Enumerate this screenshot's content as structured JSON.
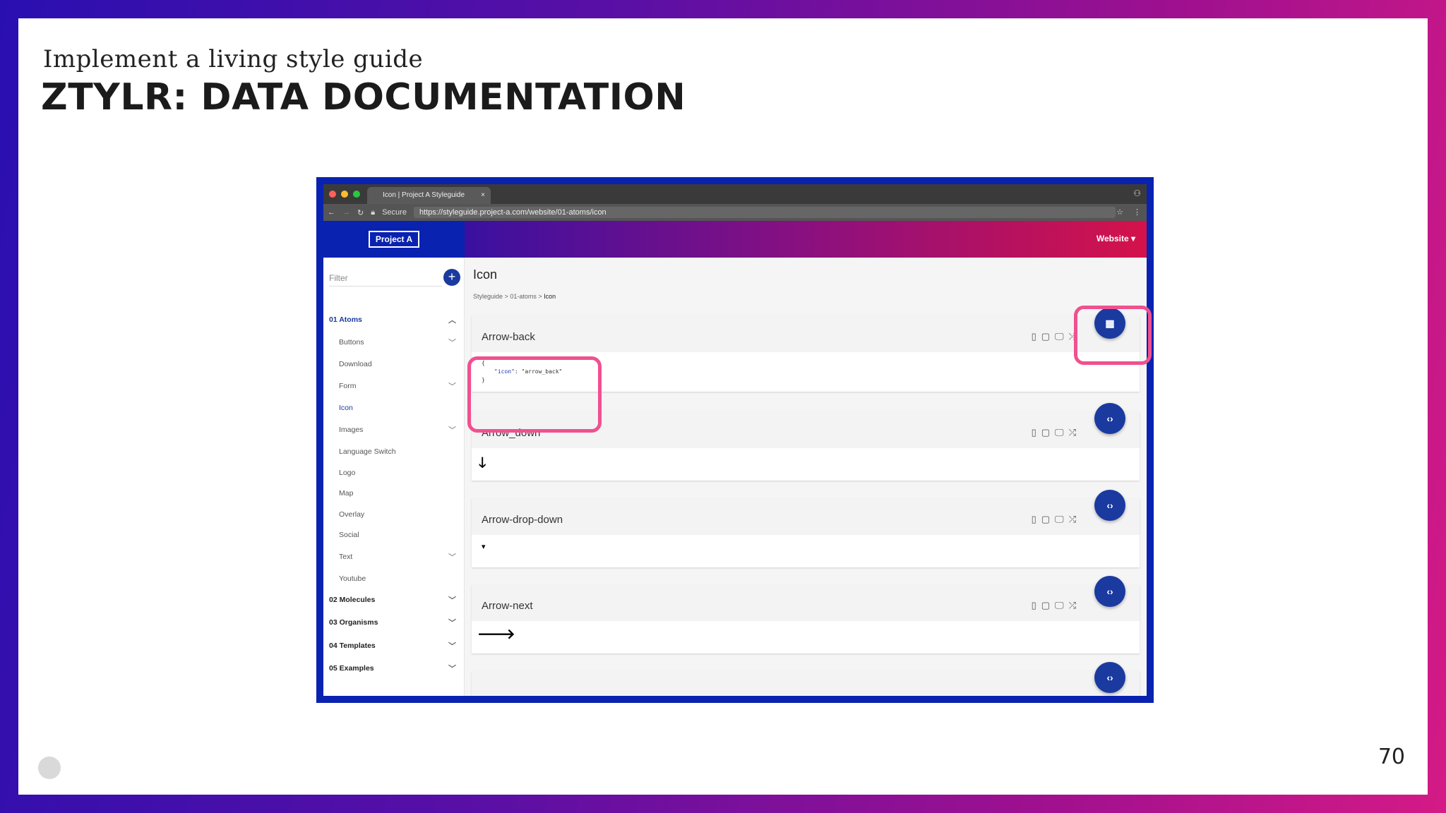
{
  "slide": {
    "subtitle": "Implement a living style guide",
    "title": "ZTYLR: DATA DOCUMENTATION",
    "page_number": "70"
  },
  "browser": {
    "tab_title": "Icon | Project A Styleguide",
    "tab_close": "×",
    "secure_label": "Secure",
    "url": "https://styleguide.project-a.com/website/01-atoms/icon"
  },
  "app": {
    "logo": "Project A",
    "site_dropdown": "Website ▾",
    "filter_placeholder": "Filter",
    "add_button": "+",
    "nav": {
      "atoms": "01 Atoms",
      "buttons": "Buttons",
      "download": "Download",
      "form": "Form",
      "icon": "Icon",
      "images": "Images",
      "language_switch": "Language Switch",
      "logo": "Logo",
      "map": "Map",
      "overlay": "Overlay",
      "social": "Social",
      "text": "Text",
      "youtube": "Youtube",
      "molecules": "02 Molecules",
      "organisms": "03 Organisms",
      "templates": "04 Templates",
      "examples": "05 Examples"
    },
    "page_title": "Icon",
    "breadcrumb": {
      "a": "Styleguide",
      "sep1": ">",
      "b": "01-atoms",
      "sep2": ">",
      "c": "Icon"
    },
    "cards": [
      {
        "title": "Arrow-back",
        "code_open": "{",
        "code_key": "\"icon\"",
        "code_val": ": \"arrow_back\"",
        "code_close": "}"
      },
      {
        "title": "Arrow_down",
        "preview": "🡓"
      },
      {
        "title": "Arrow-drop-down",
        "preview": "▾"
      },
      {
        "title": "Arrow-next",
        "preview": "🡒"
      }
    ]
  },
  "colors": {
    "accent": "#1a3aa0",
    "highlight": "#f0508f"
  }
}
